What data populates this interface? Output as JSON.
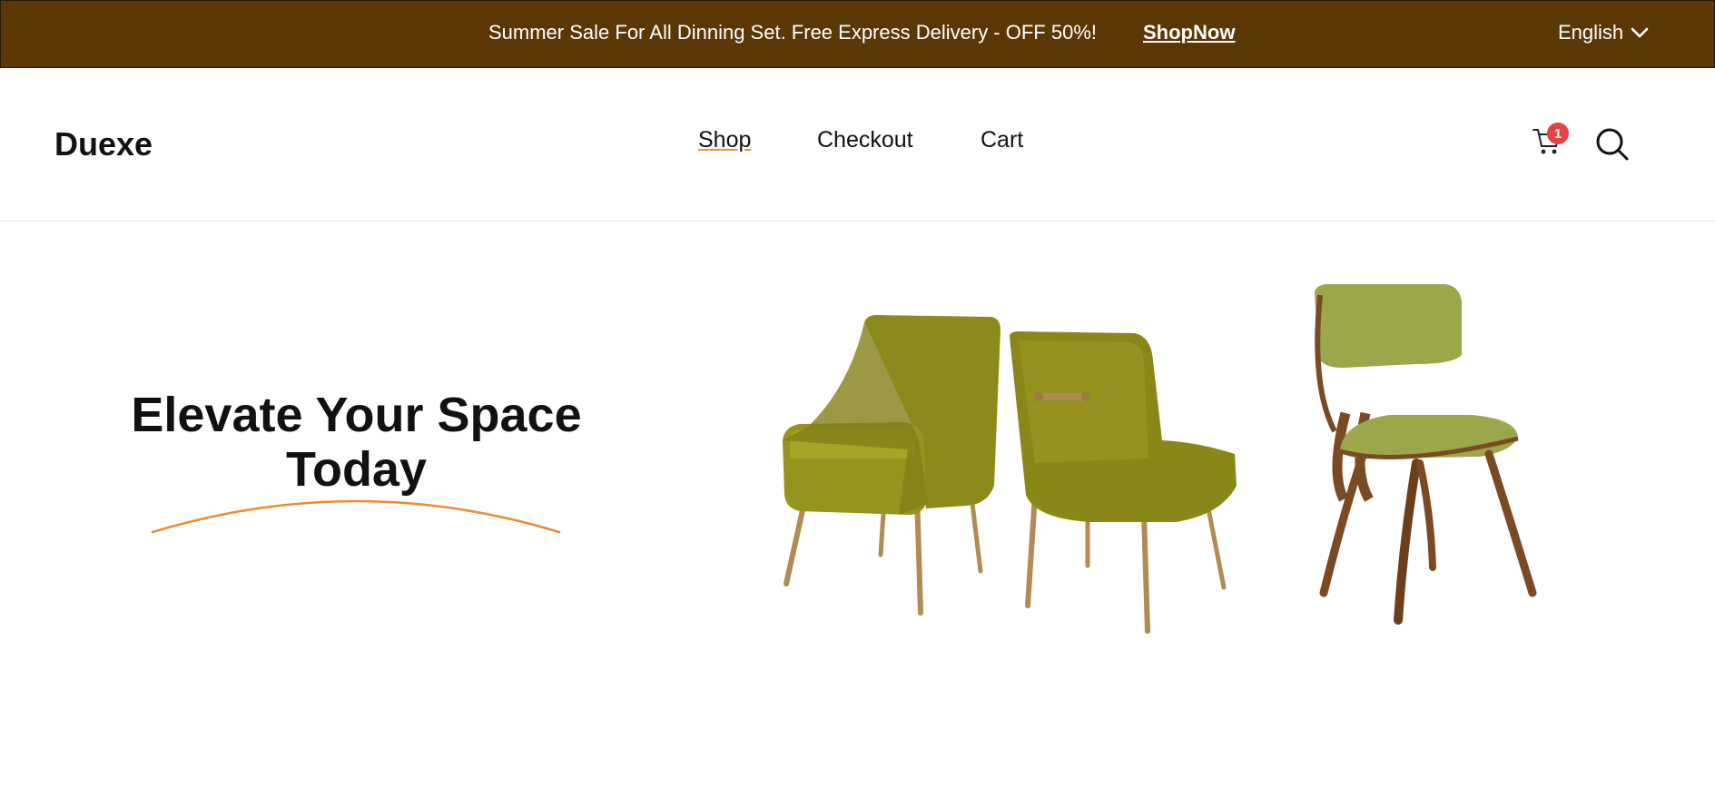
{
  "promo": {
    "text": "Summer Sale For All Dinning Set. Free Express Delivery - OFF 50%!",
    "link_label": "ShopNow",
    "language": "English"
  },
  "header": {
    "logo": "Duexe",
    "nav": [
      {
        "label": "Shop",
        "active": true
      },
      {
        "label": "Checkout",
        "active": false
      },
      {
        "label": "Cart",
        "active": false
      }
    ],
    "cart_count": "1",
    "icons": {
      "cart": "cart-icon",
      "search": "search-icon",
      "dropdown": "chevron-down-icon"
    }
  },
  "hero": {
    "title": "Elevate Your Space Today",
    "image": "green dining chairs product photo"
  },
  "colors": {
    "topbar_bg": "#5a3705",
    "accent": "#f08a2e",
    "badge": "#e54343",
    "chair_velvet": "#8d8a1c",
    "chair_fabric": "#9ca64a",
    "wood": "#7a4a22",
    "brass": "#b08b52"
  }
}
